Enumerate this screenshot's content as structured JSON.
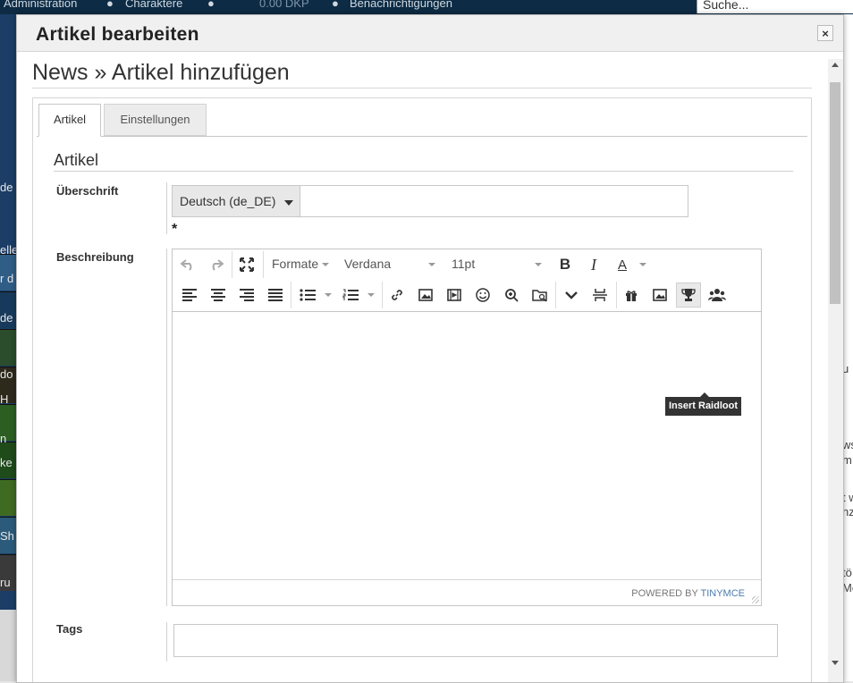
{
  "background": {
    "topbar": {
      "administration": "Administration",
      "characters": "Charaktere",
      "dkp": "0.00 DKP",
      "notifications": "Benachrichtigungen"
    },
    "search_placeholder": "Suche...",
    "left_fragments": [
      "de",
      "elle",
      "r d",
      "de",
      "do",
      "H",
      "n",
      "ke",
      "Sh",
      "ru"
    ],
    "right_fragments": [
      "u",
      "ws",
      "m",
      "t w",
      "nz",
      "tö",
      "Me"
    ]
  },
  "dialog": {
    "title": "Artikel bearbeiten",
    "close_label": "×",
    "page_title": "News » Artikel hinzufügen",
    "tabs": [
      {
        "label": "Artikel"
      },
      {
        "label": "Einstellungen"
      }
    ],
    "section_title": "Artikel",
    "fields": {
      "heading_label": "Überschrift",
      "language": "Deutsch (de_DE)",
      "heading_value": "",
      "required_mark": "*",
      "description_label": "Beschreibung",
      "tags_label": "Tags",
      "tags_value": ""
    },
    "editor": {
      "format_label": "Formate",
      "font_family": "Verdana",
      "font_size": "11pt",
      "bold_label": "B",
      "italic_label": "I",
      "text_color_label": "A",
      "tooltip": "Insert Raidloot",
      "powered_by": "POWERED BY ",
      "powered_by_brand": "TINYMCE",
      "content": ""
    }
  },
  "colors": {
    "link_blue": "#4a7ab0",
    "tooltip_bg": "#333333",
    "header_bg": "#f0f0f0",
    "topbar_bg": "#0d2b44"
  },
  "icons": [
    "undo-icon",
    "redo-icon",
    "fullscreen-icon",
    "bold-icon",
    "italic-icon",
    "text-color-icon",
    "align-left-icon",
    "align-center-icon",
    "align-right-icon",
    "justify-icon",
    "bullet-list-icon",
    "numbered-list-icon",
    "link-icon",
    "image-icon",
    "media-icon",
    "emoticon-icon",
    "zoom-icon",
    "file-manager-icon",
    "chevron-down-icon",
    "page-break-icon",
    "gift-icon",
    "picture-icon",
    "trophy-icon",
    "users-icon",
    "close-icon"
  ]
}
